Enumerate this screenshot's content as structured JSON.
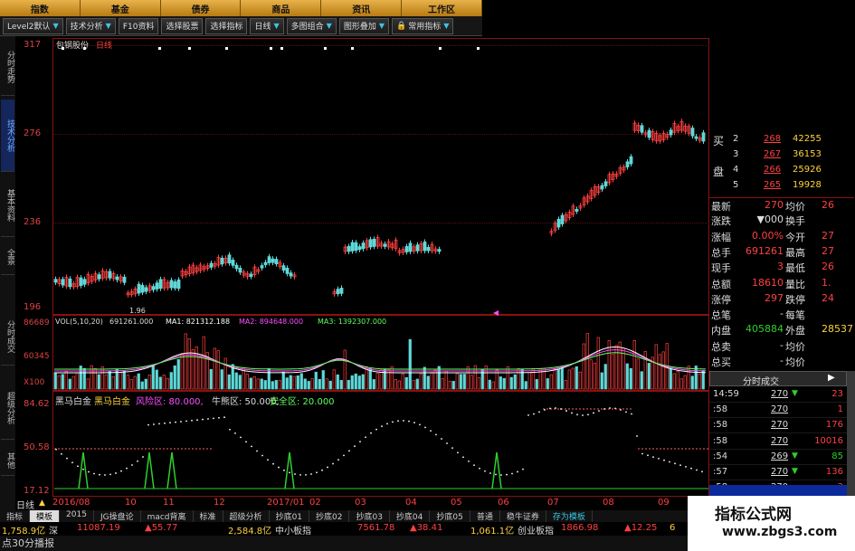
{
  "topnav": [
    "指数",
    "基金",
    "债券",
    "商品",
    "资讯",
    "工作区"
  ],
  "toolbar": [
    "Level2默认",
    "技术分析",
    "F10资料",
    "选择股票",
    "选择指标",
    "日线",
    "多图组合",
    "图形叠加",
    "常用指标"
  ],
  "lefttabs": [
    "分时走势",
    "技术分析",
    "基本资料",
    "全景",
    "分时成交",
    "超级分析",
    "其他"
  ],
  "stock": {
    "title": "包钢股份",
    "period": "日线"
  },
  "price_axis": [
    "317",
    "276",
    "236",
    "196"
  ],
  "vol_axis": [
    "86689",
    "60345",
    "X100"
  ],
  "vol_info": {
    "label": "VOL(5,10,20)",
    "vol": "691261.000",
    "ma1": "MA1: 821312.188",
    "ma2": "MA2: 894648.000",
    "ma3": "MA3: 1392307.000"
  },
  "low_label": "1.96",
  "ind_axis": [
    "84.62",
    "50.58",
    "17.12"
  ],
  "ind_info": {
    "name": "黑马白金",
    "name2": "黑马白金",
    "risk": "风险区: 80.000,",
    "bull": "牛熊区: 50.000,",
    "safe": "安全区: 20.000"
  },
  "date_axis": [
    "日线",
    "2016/08",
    "10",
    "11",
    "12",
    "2017/01",
    "02",
    "03",
    "04",
    "05",
    "06",
    "07",
    "08",
    "09"
  ],
  "order_book": [
    {
      "side": "买",
      "n": "2",
      "price": "268",
      "vol": "42255"
    },
    {
      "side": "",
      "n": "3",
      "price": "267",
      "vol": "36153"
    },
    {
      "side": "盘",
      "n": "4",
      "price": "266",
      "vol": "25926"
    },
    {
      "side": "",
      "n": "5",
      "price": "265",
      "vol": "19928"
    }
  ],
  "quote": [
    {
      "l": "最新",
      "v": "270",
      "l2": "均价",
      "v2": "26"
    },
    {
      "l": "涨跌",
      "v": "▼000",
      "l2": "换手",
      "v2": ""
    },
    {
      "l": "涨幅",
      "v": "0.00%",
      "l2": "今开",
      "v2": "27"
    },
    {
      "l": "总手",
      "v": "691261",
      "l2": "最高",
      "v2": "27"
    },
    {
      "l": "现手",
      "v": "3",
      "l2": "最低",
      "v2": "26"
    },
    {
      "l": "总额",
      "v": "18610",
      "l2": "量比",
      "v2": "1."
    },
    {
      "l": "涨停",
      "v": "297",
      "l2": "跌停",
      "v2": "24"
    },
    {
      "l": "总笔",
      "v": "-",
      "l2": "每笔",
      "v2": ""
    },
    {
      "l": "内盘",
      "v": "405884",
      "l2": "外盘",
      "v2": "28537"
    },
    {
      "l": "总卖",
      "v": "-",
      "l2": "均价",
      "v2": ""
    },
    {
      "l": "总买",
      "v": "-",
      "l2": "均价",
      "v2": ""
    }
  ],
  "trades_header": "分时成交",
  "trades": [
    {
      "t": "14:59",
      "p": "270",
      "d": "▼",
      "v": "23",
      "vc": "#ff4040"
    },
    {
      "t": ":58",
      "p": "270",
      "d": "",
      "v": "1",
      "vc": "#ff4040"
    },
    {
      "t": ":58",
      "p": "270",
      "d": "",
      "v": "176",
      "vc": "#ff4040"
    },
    {
      "t": ":58",
      "p": "270",
      "d": "",
      "v": "10016",
      "vc": "#ff4040"
    },
    {
      "t": ":54",
      "p": "269",
      "d": "▼",
      "v": "85",
      "vc": "#2ecf2e"
    },
    {
      "t": ":57",
      "p": "270",
      "d": "▼",
      "v": "136",
      "vc": "#ff4040"
    },
    {
      "t": ":58",
      "p": "270",
      "d": "",
      "v": "3",
      "vc": "#ff4040"
    }
  ],
  "bottomtabs": [
    "指标",
    "模板",
    "2015",
    "JG操盘论",
    "macd背离",
    "标准",
    "超级分析",
    "抄底01",
    "抄底02",
    "抄底03",
    "抄底04",
    "抄底05",
    "普通",
    "稳牛证券",
    "存为模板"
  ],
  "ticker": [
    {
      "v": "1,758.9亿",
      "l": "深",
      "c": "#ffd23c"
    },
    {
      "v": "11087.19",
      "l": "",
      "c": "#ff4040"
    },
    {
      "v": "▲55.77",
      "l": "",
      "c": "#ff4040"
    },
    {
      "v": "2,584.8亿",
      "l": "中小板指",
      "c": "#ffd23c"
    },
    {
      "v": "7561.78",
      "l": "",
      "c": "#ff4040"
    },
    {
      "v": "▲38.41",
      "l": "",
      "c": "#ff4040"
    },
    {
      "v": "1,061.1亿",
      "l": "创业板指",
      "c": "#ffd23c"
    },
    {
      "v": "1866.98",
      "l": "",
      "c": "#ff4040"
    },
    {
      "v": "▲12.25",
      "l": "",
      "c": "#ff4040"
    },
    {
      "v": "6",
      "l": "",
      "c": "#ffd23c"
    }
  ],
  "status": "点30分播报",
  "watermark": {
    "line1": "指标公式网",
    "line2": "www.zbgs3.com"
  },
  "colors": {
    "up": "#ff4040",
    "down": "#2ecf2e",
    "frame": "#8a1111",
    "ma1": "#ffffff",
    "ma2": "#ff4dff",
    "ma3": "#5fff5f",
    "accent": "#ffd23c"
  }
}
